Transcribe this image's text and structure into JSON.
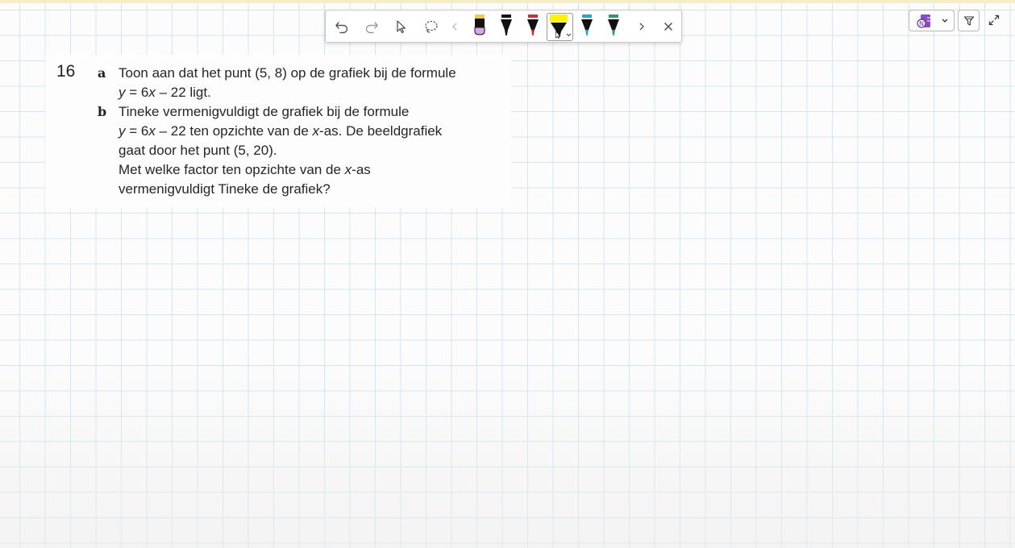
{
  "toolbar": {
    "tools": [
      {
        "name": "undo-icon"
      },
      {
        "name": "redo-icon"
      },
      {
        "name": "select-cursor-icon"
      },
      {
        "name": "lasso-icon"
      },
      {
        "name": "chevron-left-icon"
      }
    ],
    "pens": [
      {
        "name": "pen-lilac",
        "tip_color": "#e6b8e6",
        "cap_color": "#f2c94c"
      },
      {
        "name": "pen-black",
        "tip_color": "#1a1a1a",
        "cap_color": "#1a1a1a"
      },
      {
        "name": "pen-red",
        "tip_color": "#d62b2b",
        "cap_color": "#d62b2b"
      },
      {
        "name": "highlighter-yellow",
        "tip_color": "#fff200",
        "cap_color": "#fff200",
        "selected": true
      },
      {
        "name": "pen-blue",
        "tip_color": "#27a3d6",
        "cap_color": "#27a3d6"
      },
      {
        "name": "pen-green",
        "tip_color": "#2e9c6a",
        "cap_color": "#2e9c6a"
      }
    ],
    "more_icon": "chevron-right-icon",
    "close_icon": "close-icon"
  },
  "top_right": {
    "account_icon": "onenote-icon",
    "filter_icon": "filter-icon",
    "expand_icon": "expand-icon"
  },
  "exercise": {
    "number": "16",
    "parts": [
      {
        "letter": "a",
        "lines": [
          [
            "Toon aan dat het punt (5, 8) op de grafiek bij de formule"
          ],
          [
            {
              "i": "y"
            },
            " = 6",
            {
              "i": "x"
            },
            " – 22 ligt."
          ]
        ]
      },
      {
        "letter": "b",
        "lines": [
          [
            "Tineke vermenigvuldigt de grafiek bij de formule"
          ],
          [
            {
              "i": "y"
            },
            " = 6",
            {
              "i": "x"
            },
            " – 22 ten opzichte van de ",
            {
              "i": "x"
            },
            "-as. De beeldgrafiek"
          ],
          [
            "gaat door het punt (5, 20)."
          ],
          [
            "Met welke factor ten opzichte van de ",
            {
              "i": "x"
            },
            "-as"
          ],
          [
            "vermenigvuldigt Tineke de grafiek?"
          ]
        ]
      }
    ]
  }
}
